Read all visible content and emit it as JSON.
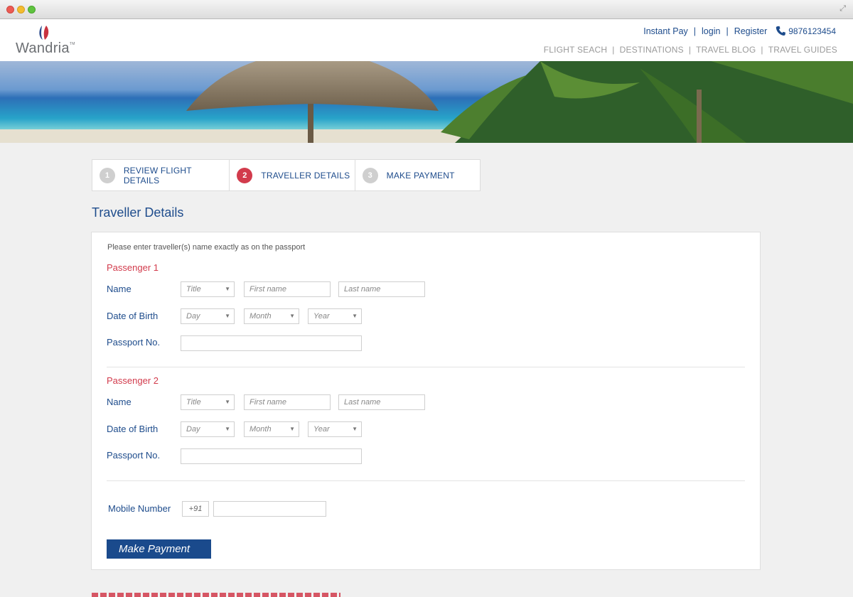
{
  "header": {
    "brand": "Wandria",
    "brand_tm": "TM",
    "top_links": [
      "Instant Pay",
      "login",
      "Register"
    ],
    "phone": "9876123454",
    "nav": [
      "FLIGHT SEACH",
      "DESTINATIONS",
      "TRAVEL BLOG",
      "TRAVEL GUIDES"
    ]
  },
  "steps": [
    {
      "num": "1",
      "label": "REVIEW FLIGHT DETAILS",
      "active": false
    },
    {
      "num": "2",
      "label": "TRAVELLER DETAILS",
      "active": true
    },
    {
      "num": "3",
      "label": "MAKE PAYMENT",
      "active": false
    }
  ],
  "section_title": "Traveller Details",
  "form": {
    "note": "Please enter traveller(s) name exactly as on the passport",
    "labels": {
      "name": "Name",
      "dob": "Date of Birth",
      "passport": "Passport No."
    },
    "placeholders": {
      "title": "Title",
      "first_name": "First name",
      "last_name": "Last name",
      "day": "Day",
      "month": "Month",
      "year": "Year"
    },
    "passengers": [
      {
        "title": "Passenger 1",
        "passport_value": ""
      },
      {
        "title": "Passenger 2",
        "passport_value": ""
      }
    ],
    "mobile_label": "Mobile Number",
    "country_code": "+91",
    "mobile_value": "",
    "submit_label": "Make Payment"
  },
  "colors": {
    "brand_blue": "#1e4c8c",
    "accent_red": "#d23b4c",
    "button_blue": "#1a4a8c"
  }
}
